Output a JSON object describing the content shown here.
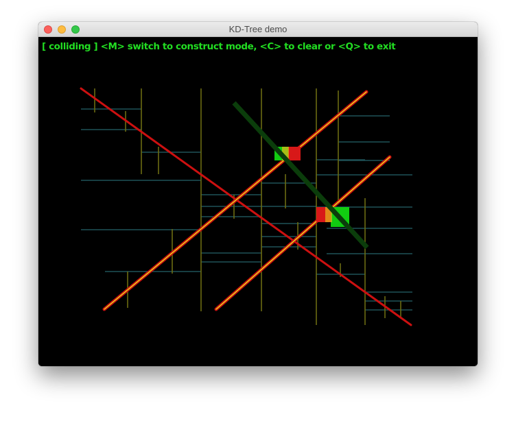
{
  "window": {
    "title": "KD-Tree demo"
  },
  "status": {
    "state": "[ colliding ]",
    "instructions": " <M> switch to construct mode, <C> to clear or <Q> to exit",
    "color": "#22dd22"
  },
  "colors": {
    "background": "#000000",
    "vertical_split": "#6b6b12",
    "horizontal_split": "#1f5258",
    "segment_red": "#cc1010",
    "segment_highlight": "#e6e61a",
    "probe": "#0b3d0b",
    "hit_green": "#11cc11",
    "hit_red": "#d81818"
  },
  "icons": [
    "close-button",
    "minimize-button",
    "zoom-button"
  ]
}
